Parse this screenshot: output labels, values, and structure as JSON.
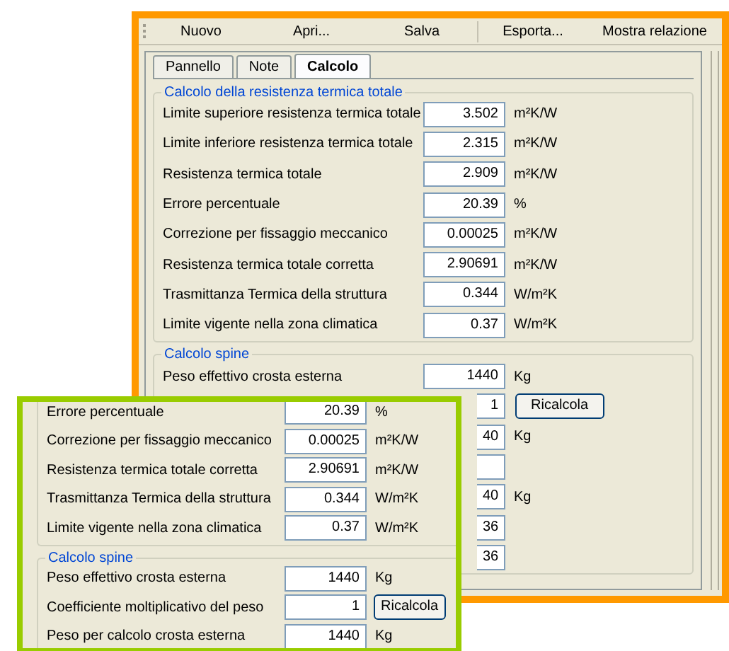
{
  "toolbar": {
    "buttons": [
      "Nuovo",
      "Apri...",
      "Salva",
      "Esporta...",
      "Mostra relazione"
    ]
  },
  "tabs": [
    {
      "label": "Pannello",
      "selected": false
    },
    {
      "label": "Note",
      "selected": false
    },
    {
      "label": "Calcolo",
      "selected": true
    }
  ],
  "main": {
    "sections": [
      {
        "title": "Calcolo della resistenza termica totale",
        "rows": [
          {
            "label": "Limite superiore resistenza termica totale",
            "value": "3.502",
            "unit": "m²K/W"
          },
          {
            "label": "Limite inferiore resistenza termica totale",
            "value": "2.315",
            "unit": "m²K/W"
          },
          {
            "label": "Resistenza termica totale",
            "value": "2.909",
            "unit": "m²K/W"
          },
          {
            "label": "Errore percentuale",
            "value": "20.39",
            "unit": "%"
          },
          {
            "label": "Correzione per fissaggio meccanico",
            "value": "0.00025",
            "unit": "m²K/W"
          },
          {
            "label": "Resistenza termica totale corretta",
            "value": "2.90691",
            "unit": "m²K/W"
          },
          {
            "label": "Trasmittanza Termica della struttura",
            "value": "0.344",
            "unit": "W/m²K"
          },
          {
            "label": "Limite vigente nella zona climatica",
            "value": "0.37",
            "unit": "W/m²K"
          }
        ]
      },
      {
        "title": "Calcolo spine",
        "rows": [
          {
            "label": "Peso effettivo crosta esterna",
            "value": "1440",
            "unit": "Kg"
          },
          {
            "value": "1",
            "button": "Ricalcola"
          },
          {
            "value": "40",
            "unit": "Kg"
          },
          {},
          {
            "value": "40",
            "unit": "Kg"
          },
          {
            "value": "36"
          },
          {
            "value": "36"
          }
        ]
      }
    ]
  },
  "inset": {
    "sections": [
      {
        "rows": [
          {
            "label": "Errore percentuale",
            "value": "20.39",
            "unit": "%"
          },
          {
            "label": "Correzione per fissaggio meccanico",
            "value": "0.00025",
            "unit": "m²K/W"
          },
          {
            "label": "Resistenza termica totale corretta",
            "value": "2.90691",
            "unit": "m²K/W"
          },
          {
            "label": "Trasmittanza Termica della struttura",
            "value": "0.344",
            "unit": "W/m²K"
          },
          {
            "label": "Limite vigente nella zona climatica",
            "value": "0.37",
            "unit": "W/m²K"
          }
        ]
      },
      {
        "title": "Calcolo spine",
        "rows": [
          {
            "label": "Peso effettivo crosta esterna",
            "value": "1440",
            "unit": "Kg"
          },
          {
            "label": "Coefficiente moltiplicativo del peso",
            "value": "1",
            "button": "Ricalcola"
          },
          {
            "label": "Peso per calcolo crosta esterna",
            "value": "1440",
            "unit": "Kg"
          }
        ]
      }
    ]
  }
}
